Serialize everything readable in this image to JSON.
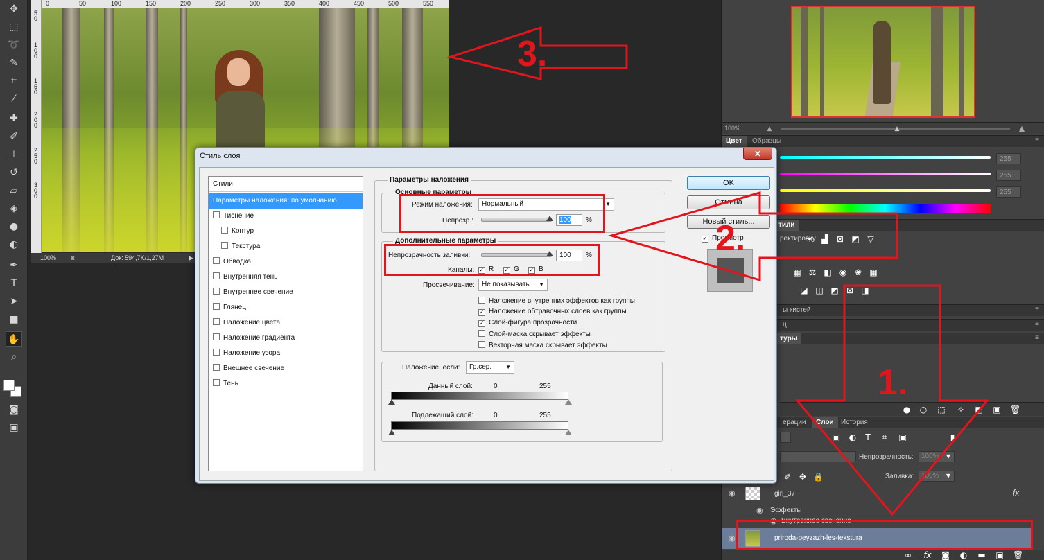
{
  "toolbar": {
    "tools": [
      "move-tool",
      "marquee-tool",
      "lasso-tool",
      "quick-select-tool",
      "crop-tool",
      "eyedropper-tool",
      "healing-brush-tool",
      "brush-tool",
      "clone-stamp-tool",
      "history-brush-tool",
      "eraser-tool",
      "paint-bucket-tool",
      "blur-tool",
      "dodge-tool",
      "pen-tool",
      "type-tool",
      "path-select-tool",
      "rectangle-tool",
      "hand-tool",
      "zoom-tool"
    ],
    "active_tool": "hand-tool"
  },
  "document": {
    "ruler_top": [
      "0",
      "50",
      "100",
      "150",
      "200",
      "250",
      "300",
      "350",
      "400",
      "450",
      "500",
      "550"
    ],
    "ruler_left": [
      "5",
      "0",
      "1",
      "0",
      "0",
      "1",
      "5",
      "0",
      "2",
      "0",
      "0",
      "2",
      "5",
      "0",
      "3",
      "0",
      "0"
    ],
    "zoom": "100%",
    "doc_info": "Док: 594,7K/1,27M"
  },
  "navigator": {
    "zoom": "100%"
  },
  "color_panel": {
    "tabs": [
      "Цвет",
      "Образцы"
    ],
    "values": [
      "255",
      "255",
      "255"
    ]
  },
  "adjustments_panel": {
    "tab_fragment": "тили",
    "title_fragment": "ректировку"
  },
  "brush_panel": {
    "tab_fragment": "ы кистей"
  },
  "char_panel": {
    "tab_fragment": "ц"
  },
  "paths_panel": {
    "tab_fragment": "туры"
  },
  "layers_panel": {
    "tabs": [
      "ерации",
      "Слои",
      "История"
    ],
    "opacity_label": "Непрозрачность:",
    "opacity_value": "100%",
    "fill_label": "Заливка:",
    "fill_value": "100%",
    "layers": [
      {
        "name": "girl_37",
        "fx": "fx"
      },
      {
        "name": "Эффекты"
      },
      {
        "name": "Внутреннее свечение"
      },
      {
        "name": "priroda-peyzazh-les-tekstura"
      }
    ]
  },
  "dialog": {
    "title": "Стиль слоя",
    "close": "✕",
    "styles_header": "Стили",
    "styles": [
      {
        "label": "Параметры наложения: по умолчанию",
        "checkbox": false,
        "selected": true,
        "indent": false
      },
      {
        "label": "Тиснение",
        "checkbox": true,
        "checked": false,
        "indent": false
      },
      {
        "label": "Контур",
        "checkbox": true,
        "checked": false,
        "indent": true
      },
      {
        "label": "Текстура",
        "checkbox": true,
        "checked": false,
        "indent": true
      },
      {
        "label": "Обводка",
        "checkbox": true,
        "checked": false,
        "indent": false
      },
      {
        "label": "Внутренняя тень",
        "checkbox": true,
        "checked": false,
        "indent": false
      },
      {
        "label": "Внутреннее свечение",
        "checkbox": true,
        "checked": false,
        "indent": false
      },
      {
        "label": "Глянец",
        "checkbox": true,
        "checked": false,
        "indent": false
      },
      {
        "label": "Наложение цвета",
        "checkbox": true,
        "checked": false,
        "indent": false
      },
      {
        "label": "Наложение градиента",
        "checkbox": true,
        "checked": false,
        "indent": false
      },
      {
        "label": "Наложение узора",
        "checkbox": true,
        "checked": false,
        "indent": false
      },
      {
        "label": "Внешнее свечение",
        "checkbox": true,
        "checked": false,
        "indent": false
      },
      {
        "label": "Тень",
        "checkbox": true,
        "checked": false,
        "indent": false
      }
    ],
    "blending_title": "Параметры наложения",
    "general_title": "Основные параметры",
    "blend_mode_label": "Режим наложения:",
    "blend_mode_value": "Нормальный",
    "opacity_label": "Непрозр.:",
    "opacity_value": "100",
    "percent": "%",
    "advanced_title": "Дополнительные параметры",
    "fill_opacity_label": "Непрозрачность заливки:",
    "fill_opacity_value": "100",
    "channels_label": "Каналы:",
    "channels": [
      {
        "label": "R",
        "checked": true
      },
      {
        "label": "G",
        "checked": true
      },
      {
        "label": "B",
        "checked": true
      }
    ],
    "knockout_label": "Просвечивание:",
    "knockout_value": "Не показывать",
    "options": [
      {
        "label": "Наложение внутренних эффектов как группы",
        "checked": false
      },
      {
        "label": "Наложение обтравочных слоев как группы",
        "checked": true
      },
      {
        "label": "Слой-фигура прозрачности",
        "checked": true
      },
      {
        "label": "Слой-маска скрывает эффекты",
        "checked": false
      },
      {
        "label": "Векторная маска скрывает эффекты",
        "checked": false
      }
    ],
    "blend_if_label": "Наложение, если:",
    "blend_if_value": "Гр.сер.",
    "this_layer_label": "Данный слой:",
    "this_layer_min": "0",
    "this_layer_max": "255",
    "underlying_label": "Подлежащий слой:",
    "underlying_min": "0",
    "underlying_max": "255",
    "buttons": {
      "ok": "OK",
      "cancel": "Отмена",
      "new_style": "Новый стиль...",
      "preview": "Просмотр",
      "preview_checked": true
    }
  },
  "annotations": {
    "labels": [
      "1.",
      "2.",
      "3."
    ],
    "color": "#e2151d"
  }
}
